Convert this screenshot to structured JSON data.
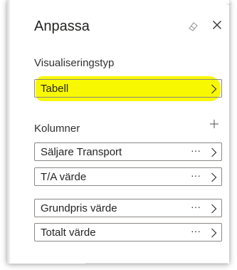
{
  "pane": {
    "title": "Anpassa",
    "eraser_icon": "eraser-icon",
    "close_icon": "close-icon"
  },
  "visualization": {
    "label": "Visualiseringstyp",
    "selected": "Tabell",
    "highlight_color": "#f8f800"
  },
  "columns": {
    "label": "Kolumner",
    "add_icon": "plus-icon",
    "items": [
      {
        "label": "Säljare Transport",
        "more": "···"
      },
      {
        "label": "T/A värde",
        "more": "···"
      },
      {
        "label": "Grundpris värde",
        "more": "···"
      },
      {
        "label": "Totalt värde",
        "more": "···"
      }
    ]
  }
}
